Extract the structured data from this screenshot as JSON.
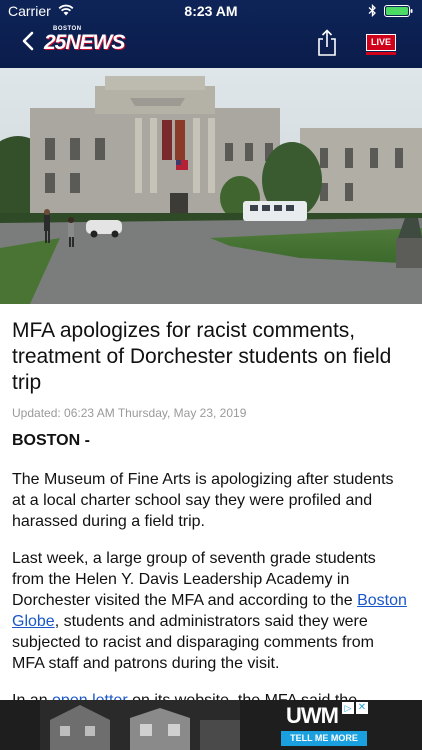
{
  "status_bar": {
    "carrier": "Carrier",
    "time": "8:23 AM"
  },
  "header": {
    "brand_small": "BOSTON",
    "brand_main": "25NEWS",
    "live_label": "LIVE"
  },
  "icons": {
    "back": "chevron-left-icon",
    "share": "share-icon",
    "wifi": "wifi-icon",
    "bluetooth": "bluetooth-icon",
    "battery": "battery-icon"
  },
  "colors": {
    "header_bg": "#0c1f52",
    "live_red": "#d0021b",
    "link_blue": "#1a57c8",
    "ad_cta_blue": "#1aa0df"
  },
  "article": {
    "headline": "MFA apologizes for racist comments, treatment of Dorchester students on field trip",
    "updated": "Updated: 06:23 AM Thursday, May 23, 2019",
    "dateline": "BOSTON -",
    "p1": "The Museum of Fine Arts is apologizing after students at a local charter school say they were profiled and harassed during a field trip.",
    "p2_part1": "Last week, a large group of seventh grade students from the Helen Y. Davis Leadership Academy in Dorchester visited the MFA and according to the ",
    "p2_link": "Boston Globe",
    "p2_part2": ", students and administrators said they were subjected to racist and disparaging comments from MFA staff and patrons during the visit.",
    "p3_part1": "In an ",
    "p3_link": "open letter",
    "p3_part2": " on its website, the MFA said the"
  },
  "ad": {
    "logo": "UWM",
    "info": "▷",
    "close": "✕",
    "cta": "TELL ME MORE"
  }
}
